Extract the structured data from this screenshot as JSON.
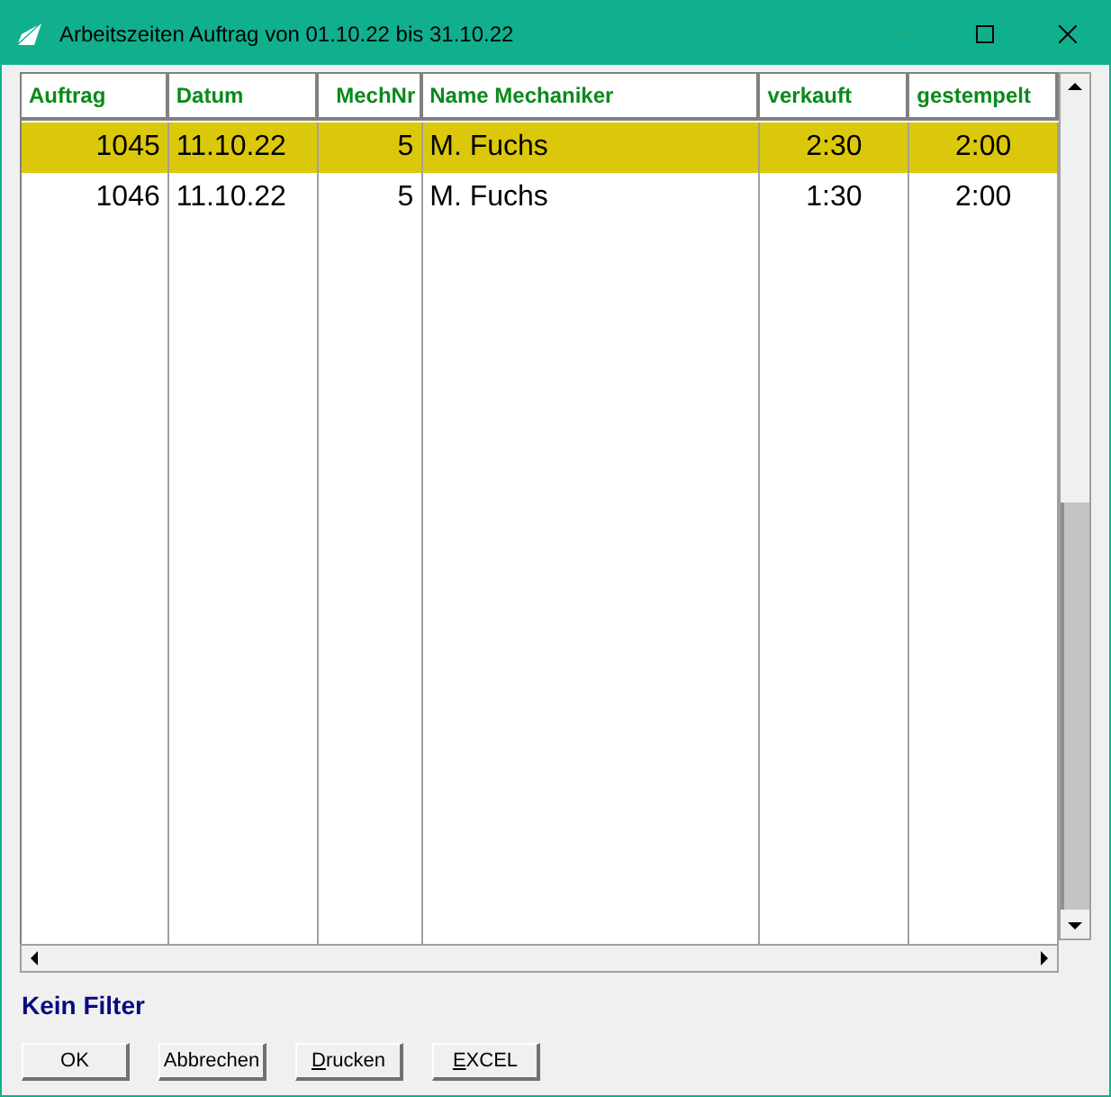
{
  "window": {
    "title": "Arbeitszeiten Auftrag von 01.10.22 bis 31.10.22"
  },
  "table": {
    "columns": [
      {
        "label": "Auftrag",
        "kind": "number"
      },
      {
        "label": "Datum",
        "kind": "text"
      },
      {
        "label": "MechNr",
        "kind": "number"
      },
      {
        "label": "Name Mechaniker",
        "kind": "text"
      },
      {
        "label": "verkauft",
        "kind": "time"
      },
      {
        "label": "gestempelt",
        "kind": "time"
      }
    ],
    "rows": [
      {
        "selected": true,
        "cells": [
          "1045",
          "11.10.22",
          "5",
          "M. Fuchs",
          "2:30",
          "2:00"
        ]
      },
      {
        "selected": false,
        "cells": [
          "1046",
          "11.10.22",
          "5",
          "M. Fuchs",
          "1:30",
          "2:00"
        ]
      }
    ]
  },
  "filter_label": "Kein Filter",
  "buttons": [
    {
      "label": "OK",
      "mnemonic": false
    },
    {
      "label": "Abbrechen",
      "mnemonic": false
    },
    {
      "label": "Drucken",
      "mnemonic": true
    },
    {
      "label": "EXCEL",
      "mnemonic": true
    }
  ]
}
